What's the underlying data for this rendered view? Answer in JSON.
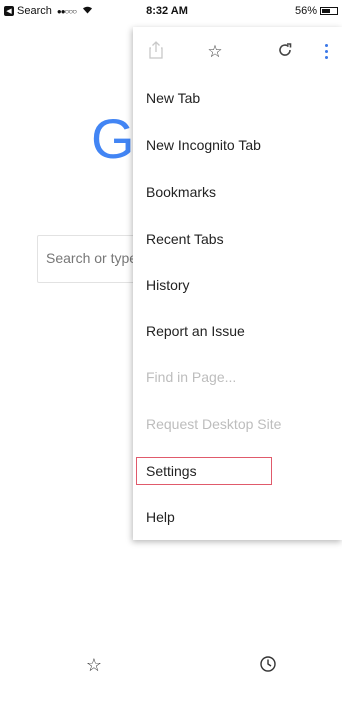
{
  "status_bar": {
    "carrier": "Search",
    "signal": "●●○○○",
    "time": "8:32 AM",
    "battery_text": "56%",
    "battery_level": 0.56
  },
  "page": {
    "logo_text": "G",
    "search_placeholder": "Search or type"
  },
  "menu": {
    "top_icons": [
      "share-icon",
      "star-icon",
      "reload-icon",
      "more-vert-icon"
    ],
    "items": [
      {
        "label": "New Tab",
        "enabled": true
      },
      {
        "label": "New Incognito Tab",
        "enabled": true
      },
      {
        "label": "Bookmarks",
        "enabled": true
      },
      {
        "label": "Recent Tabs",
        "enabled": true
      },
      {
        "label": "History",
        "enabled": true
      },
      {
        "label": "Report an Issue",
        "enabled": true
      },
      {
        "label": "Find in Page...",
        "enabled": false
      },
      {
        "label": "Request Desktop Site",
        "enabled": false
      },
      {
        "label": "Settings",
        "enabled": true,
        "highlighted": true
      },
      {
        "label": "Help",
        "enabled": true
      }
    ],
    "highlight_color": "#e05a6b"
  },
  "bottom_bar": {
    "icons": [
      "star-icon",
      "history-clock-icon"
    ]
  },
  "colors": {
    "google_blue": "#4285f4",
    "accent_dots": "#3b78e7",
    "disabled_text": "#bdbdbd"
  }
}
